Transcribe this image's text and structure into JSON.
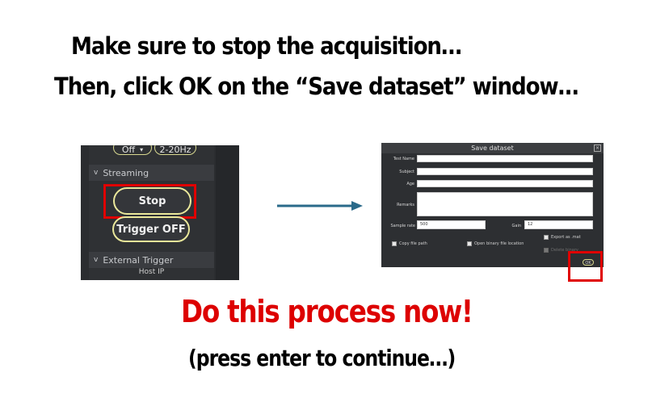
{
  "instructions": {
    "line1": "Make sure to stop the acquisition…",
    "line2": "Then, click OK on the “Save dataset” window…",
    "call_to_action": "Do this process now!",
    "continue_hint": "(press enter to continue…)"
  },
  "left_panel": {
    "filter_off_label": "Off",
    "filter_band_label": "2-20Hz",
    "streaming_section": "Streaming",
    "stop_button": "Stop",
    "trigger_button": "Trigger OFF",
    "external_trigger_section": "External Trigger",
    "host_ip_label": "Host IP"
  },
  "save_dialog": {
    "title": "Save dataset",
    "fields": {
      "test_name_label": "Test Name",
      "subject_label": "Subject",
      "age_label": "Age",
      "remarks_label": "Remarks",
      "sample_rate_label": "Sample rate",
      "sample_rate_value": "500",
      "gain_label": "Gain",
      "gain_value": "12"
    },
    "options": {
      "copy_file_path": "Copy file path",
      "open_binary_location": "Open binary file location",
      "export_mat": "Export as .mat",
      "delete_label": "Delete binary"
    },
    "ok_button": "OK"
  },
  "colors": {
    "highlight_red": "#e00000",
    "arrow_blue": "#2a6a8a",
    "cta_red": "#dd0000",
    "pill_outline": "#e9e79a"
  },
  "icons": {
    "dropdown": "chevron-down-icon",
    "section_toggle": "chevron-down-icon",
    "close": "close-icon",
    "arrow": "arrow-right-icon"
  }
}
